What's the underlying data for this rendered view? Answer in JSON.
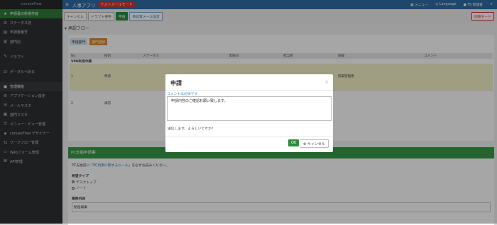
{
  "sidebar": {
    "brand": "conuesFlow",
    "items": [
      {
        "icon": "star",
        "label": "申請書の新規作成",
        "active": true
      },
      {
        "icon": "list",
        "label": "ステータス別"
      },
      {
        "icon": "doc",
        "label": "申請書番号"
      },
      {
        "icon": "building",
        "label": "部門別"
      },
      {
        "icon": "pencil",
        "label": "ドラフト"
      },
      {
        "icon": "portal",
        "label": "ポータルへ戻る"
      }
    ],
    "admin": {
      "group": "管理機能",
      "items": [
        {
          "icon": "gear",
          "label": "アプリケーション設定"
        },
        {
          "icon": "mail",
          "label": "メールマスタ"
        },
        {
          "icon": "dept",
          "label": "部門マスタ"
        },
        {
          "icon": "menu",
          "label": "メニュー・ビュー管理"
        },
        {
          "icon": "designer",
          "label": "conuesFlow デザイナー"
        },
        {
          "icon": "workflow",
          "label": "ワークフロー管理"
        },
        {
          "icon": "form",
          "label": "Webフォーム管理"
        },
        {
          "icon": "api",
          "label": "API管理"
        }
      ]
    }
  },
  "topbar": {
    "title": "人事アプリ",
    "badge": "テストメールモード",
    "menu": "メニュー",
    "language": "Language",
    "user": "FS 管理者"
  },
  "toolbar": {
    "cancel": "キャンセル",
    "draft": "ドラフト保存",
    "apply": "申請",
    "notify": "承認者メール設定",
    "delete": "削除モード"
  },
  "flow": {
    "section_title": "承認フロー",
    "dept_label": "申請部門",
    "dept_value": "部門選択",
    "columns": [
      "No.",
      "役割",
      "ステータス",
      "実施日",
      "担当者",
      "詳細",
      "コメント"
    ],
    "group_row": "VPN利用申請",
    "rows": [
      {
        "no": "1",
        "role": "申請",
        "detail": "所属管理者"
      },
      {
        "no": "2",
        "role": "承認"
      }
    ]
  },
  "pc": {
    "header": "PC支給申請書",
    "note_pre": "PC支給前に「",
    "note_link": "PC利用に関するルール",
    "note_post": "」を必ずお読みください。",
    "type_label": "希望タイプ",
    "options": [
      "デスクトップ",
      "ノート"
    ],
    "selected": 0,
    "memo_label": "業務内容",
    "memo_value": "動画編集"
  },
  "modal": {
    "title": "申請",
    "close": "×",
    "hint": "コメントは必須です",
    "comment": "申請内容のご確認お願い致します。",
    "message": "送信します。よろしいですか？",
    "ok": "OK",
    "cancel": "キャンセル"
  }
}
